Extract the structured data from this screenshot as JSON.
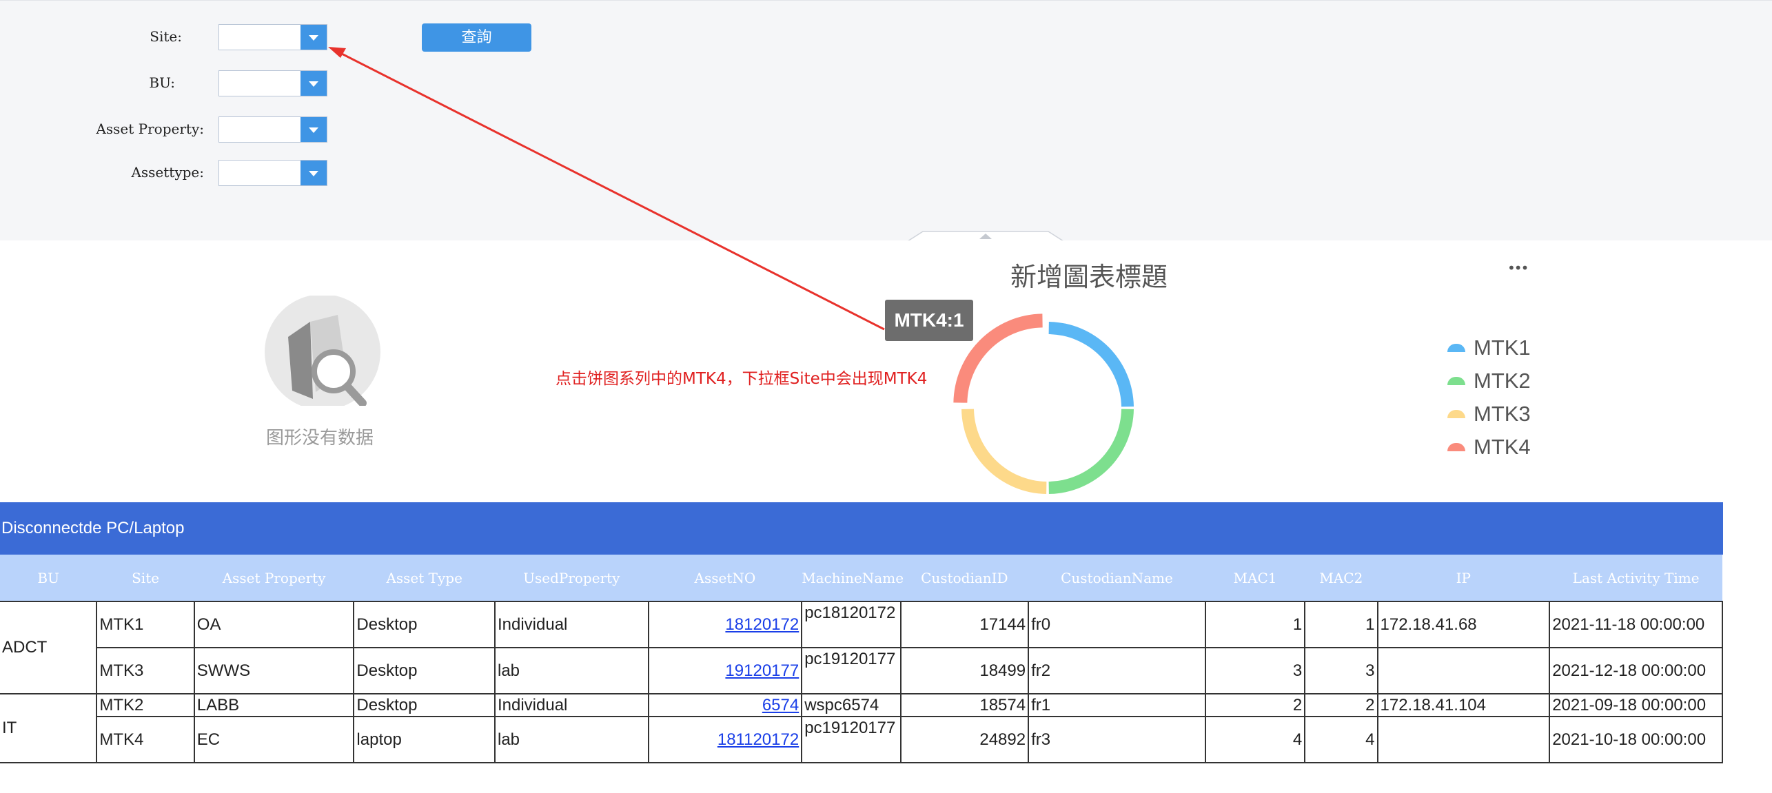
{
  "filters": {
    "site_label": "Site:",
    "bu_label": "BU:",
    "asset_property_label": "Asset Property:",
    "assettype_label": "Assettype:",
    "site_value": "",
    "bu_value": "",
    "asset_property_value": "",
    "assettype_value": "",
    "query_button": "查詢"
  },
  "empty_chart": {
    "message": "图形没有数据"
  },
  "pie_chart": {
    "more_menu": "•••",
    "tooltip": "MTK4:1",
    "legend": [
      "MTK1",
      "MTK2",
      "MTK3",
      "MTK4"
    ]
  },
  "annotation": {
    "text": "点击饼图系列中的MTK4，下拉框Site中会出现MTK4"
  },
  "chart_data": {
    "type": "pie",
    "title": "新增圖表標題",
    "categories": [
      "MTK1",
      "MTK2",
      "MTK3",
      "MTK4"
    ],
    "values": [
      1,
      1,
      1,
      1
    ],
    "colors": [
      "#5ab7f5",
      "#7ddf8e",
      "#fdd98a",
      "#fa8b7c"
    ],
    "donut": true,
    "legend_position": "right"
  },
  "table": {
    "title": "Disconnectde PC/Laptop",
    "columns": [
      "BU",
      "Site",
      "Asset Property",
      "Asset Type",
      "UsedProperty",
      "AssetNO",
      "MachineName",
      "CustodianID",
      "CustodianName",
      "MAC1",
      "MAC2",
      "IP",
      "Last Activity Time"
    ],
    "groups": [
      {
        "bu": "ADCT",
        "rows": [
          {
            "site": "MTK1",
            "asset_property": "OA",
            "asset_type": "Desktop",
            "used_property": "Individual",
            "asset_no": "18120172",
            "machine_name": "pc18120172",
            "custodian_id": "17144",
            "custodian_name": "fr0",
            "mac1": "1",
            "mac2": "1",
            "ip": "172.18.41.68",
            "last_activity": "2021-11-18 00:00:00"
          },
          {
            "site": "MTK3",
            "asset_property": "SWWS",
            "asset_type": "Desktop",
            "used_property": "lab",
            "asset_no": "19120177",
            "machine_name": "pc19120177",
            "custodian_id": "18499",
            "custodian_name": "fr2",
            "mac1": "3",
            "mac2": "3",
            "ip": "",
            "last_activity": "2021-12-18 00:00:00"
          }
        ]
      },
      {
        "bu": "IT",
        "rows": [
          {
            "site": "MTK2",
            "asset_property": "LABB",
            "asset_type": "Desktop",
            "used_property": "Individual",
            "asset_no": "6574",
            "machine_name": "wspc6574",
            "custodian_id": "18574",
            "custodian_name": "fr1",
            "mac1": "2",
            "mac2": "2",
            "ip": "172.18.41.104",
            "last_activity": "2021-09-18 00:00:00"
          },
          {
            "site": "MTK4",
            "asset_property": "EC",
            "asset_type": "laptop",
            "used_property": "lab",
            "asset_no": "181120172",
            "machine_name": "pc19120177",
            "custodian_id": "24892",
            "custodian_name": "fr3",
            "mac1": "4",
            "mac2": "4",
            "ip": "",
            "last_activity": "2021-10-18 00:00:00"
          }
        ]
      }
    ]
  }
}
